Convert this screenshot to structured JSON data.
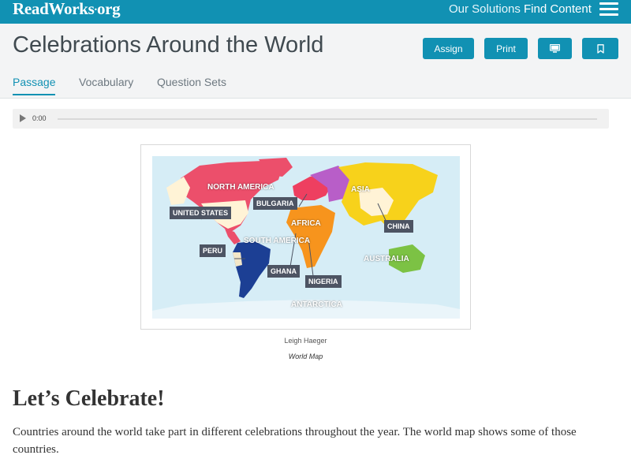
{
  "brand": {
    "logo_text": "ReadWorks",
    "logo_domain": "org"
  },
  "nav": {
    "solutions": "Our Solutions",
    "find": "Find Content",
    "menu_icon": "hamburger-menu-icon"
  },
  "article": {
    "title": "Celebrations Around the World"
  },
  "actions": {
    "assign": "Assign",
    "print": "Print",
    "present_icon": "monitor-icon",
    "bookmark_icon": "bookmark-icon"
  },
  "tabs": [
    {
      "label": "Passage",
      "active": true
    },
    {
      "label": "Vocabulary",
      "active": false
    },
    {
      "label": "Question Sets",
      "active": false
    }
  ],
  "audio": {
    "time": "0:00",
    "play_icon": "play-icon"
  },
  "figure": {
    "map": {
      "continents": {
        "north_america": "NORTH AMERICA",
        "south_america": "SOUTH AMERICA",
        "africa": "AFRICA",
        "asia": "ASIA",
        "australia": "AUSTRALIA",
        "antarctica": "ANTARCTICA"
      },
      "countries": [
        "UNITED STATES",
        "PERU",
        "BULGARIA",
        "GHANA",
        "NIGERIA",
        "CHINA"
      ]
    },
    "credit": "Leigh Haeger",
    "caption": "World Map"
  },
  "section": {
    "heading": "Let’s Celebrate!",
    "paragraph": "Countries around the world take part in different celebrations throughout the year. The world map shows some of those countries."
  },
  "colors": {
    "brand": "#1191b3",
    "north_america": "#ec4f6b",
    "united_states": "#fff3d6",
    "south_america": "#1c3f94",
    "europe": "#ee3f60",
    "africa": "#f7941d",
    "asia": "#f7d21b",
    "russia_region": "#b85ec8",
    "australia": "#7cc244",
    "antarctica": "#eaf5fa",
    "ocean": "#d6edf6",
    "label_box": "#4d5463"
  }
}
